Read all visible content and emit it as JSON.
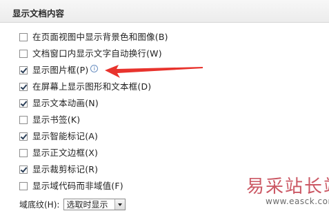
{
  "section": {
    "title": "显示文档内容"
  },
  "options": [
    {
      "label": "在页面视图中显示背景色和图像(B)",
      "checked": false,
      "info": false
    },
    {
      "label": "文档窗口内显示文字自动换行(W)",
      "checked": false,
      "info": false
    },
    {
      "label": "显示图片框(P)",
      "checked": true,
      "info": true
    },
    {
      "label": "在屏幕上显示图形和文本框(D)",
      "checked": true,
      "info": false
    },
    {
      "label": "显示文本动画(N)",
      "checked": true,
      "info": false
    },
    {
      "label": "显示书签(K)",
      "checked": false,
      "info": false
    },
    {
      "label": "显示智能标记(A)",
      "checked": true,
      "info": false
    },
    {
      "label": "显示正文边框(X)",
      "checked": false,
      "info": false
    },
    {
      "label": "显示裁剪标记(R)",
      "checked": true,
      "info": false
    },
    {
      "label": "显示域代码而非域值(F)",
      "checked": false,
      "info": false
    }
  ],
  "field_shading": {
    "label": "域底纹(H):",
    "value": "选取时显示"
  },
  "annotation": {
    "arrow_color": "#e8332d",
    "icon": "red-arrow-icon"
  },
  "watermark": {
    "text_cn": "易采站长站",
    "url": "www.easck.com"
  },
  "colors": {
    "checkmark": "#2b3f58",
    "watermark": "#c23b4a"
  }
}
